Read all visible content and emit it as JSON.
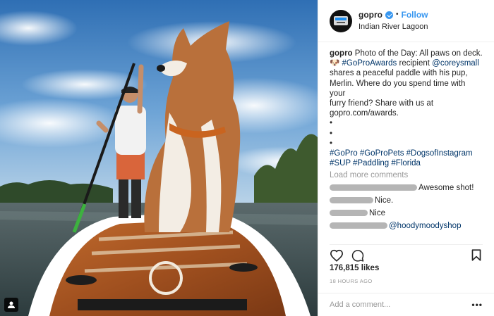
{
  "post": {
    "username": "gopro",
    "follow_label": "Follow",
    "location": "Indian River Lagoon",
    "caption": {
      "lines": [
        [
          "Photo of the Day: All paws on deck."
        ],
        [
          "🐶 ",
          "#GoProAwards",
          " recipient ",
          "@coreysmall"
        ],
        [
          "shares a peaceful paddle with his pup,"
        ],
        [
          "Merlin. Where do you spend time with your"
        ],
        [
          "furry friend? Share with us at"
        ],
        [
          "gopro.com/awards."
        ],
        [
          "•"
        ],
        [
          "•"
        ],
        [
          "•"
        ],
        [
          "#GoPro #GoProPets #DogsofInstagram"
        ],
        [
          "#SUP #Paddling #Florida"
        ]
      ]
    },
    "load_more_label": "Load more comments",
    "comments": [
      {
        "text": "Awesome shot!"
      },
      {
        "text": "Nice."
      },
      {
        "text": "Nice"
      },
      {
        "text": "@hoodymoodyshop"
      },
      {
        "text": "💫"
      },
      {
        "text": "💖"
      }
    ],
    "likes": "176,815 likes",
    "time": "18 HOURS AGO",
    "add_comment_placeholder": "Add a comment...",
    "more_label": "•••"
  },
  "icons": {
    "like": "heart-icon",
    "comment": "comment-bubble-icon",
    "save": "bookmark-icon",
    "verified": "verified-badge-icon",
    "user_tag": "person-tag-icon"
  },
  "colors": {
    "link": "#003569",
    "follow": "#3897f0",
    "muted": "#999999"
  }
}
